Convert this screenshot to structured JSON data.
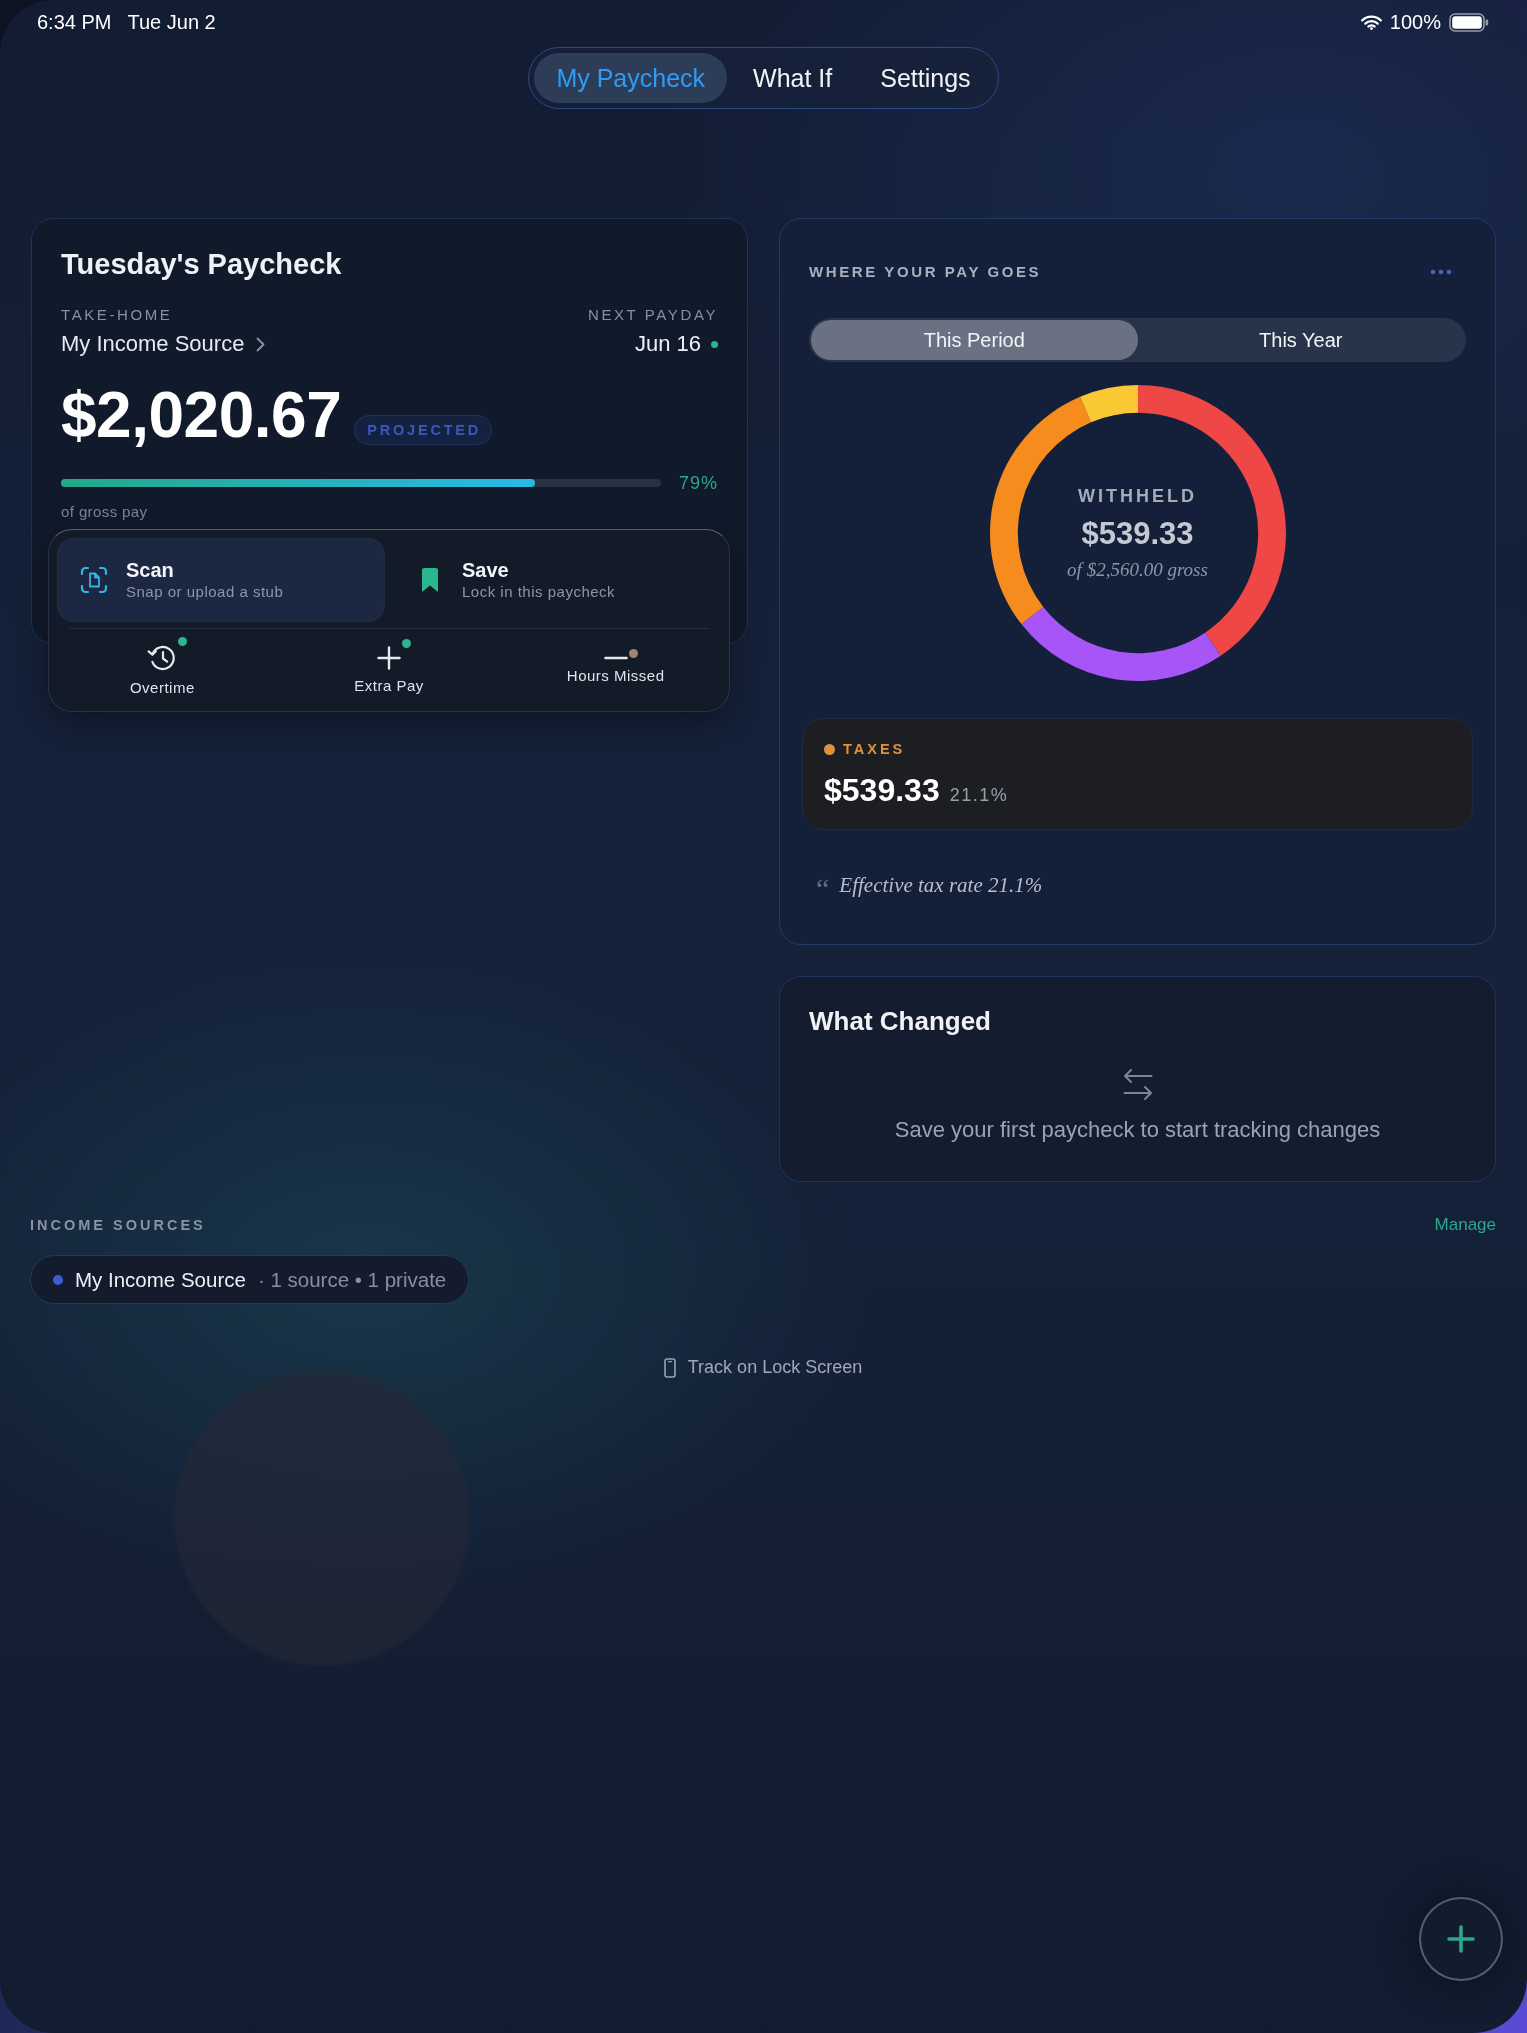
{
  "status_bar": {
    "time": "6:34 PM",
    "date": "Tue Jun 2",
    "battery": "100%"
  },
  "tabs": [
    {
      "label": "My Paycheck",
      "selected": true
    },
    {
      "label": "What If",
      "selected": false
    },
    {
      "label": "Settings",
      "selected": false
    }
  ],
  "paycheck": {
    "title": "Tuesday's Paycheck",
    "take_home_label": "TAKE-HOME",
    "source": "My Income Source",
    "next_payday_label": "NEXT PAYDAY",
    "next_payday": "Jun 16",
    "amount": "$2,020.67",
    "badge": "PROJECTED",
    "progress": {
      "level": 0.79,
      "reading": "79%"
    },
    "caption": "of gross pay"
  },
  "actions": [
    {
      "kind": "scan",
      "title": "Scan",
      "subtitle": "Snap or upload a stub",
      "highlighted": true
    },
    {
      "kind": "save",
      "title": "Save",
      "subtitle": "Lock in this paycheck",
      "highlighted": false
    }
  ],
  "adjustments": [
    {
      "kind": "overtime",
      "label": "Overtime",
      "color": "#2bb68f"
    },
    {
      "kind": "extra",
      "label": "Extra Pay",
      "color": "#2bb68f"
    },
    {
      "kind": "missed",
      "label": "Hours Missed",
      "color": "#a08570"
    }
  ],
  "breakdown": {
    "title": "WHERE YOUR PAY GOES",
    "periods": [
      {
        "label": "This Period",
        "selected": true
      },
      {
        "label": "This Year",
        "selected": false
      }
    ],
    "center_label": "WITHHELD",
    "center_amount": "$539.33",
    "center_caption": "of $2,560.00 gross",
    "categories": [
      {
        "name": "TAXES",
        "color": "#e0913a",
        "amount": "$539.33",
        "share": "21.1%"
      }
    ],
    "quote_mark": "“",
    "note": "Effective tax rate 21.1%"
  },
  "what_changed": {
    "title": "What Changed",
    "message": "Save your first paycheck to start tracking changes"
  },
  "income_sources": {
    "title": "INCOME SOURCES",
    "action": "Manage",
    "items": [
      {
        "name": "My Income Source",
        "details": "· 1 source • 1 private",
        "color": "#3d5bd9"
      }
    ]
  },
  "lock_screen": {
    "label": "Track on Lock Screen"
  }
}
